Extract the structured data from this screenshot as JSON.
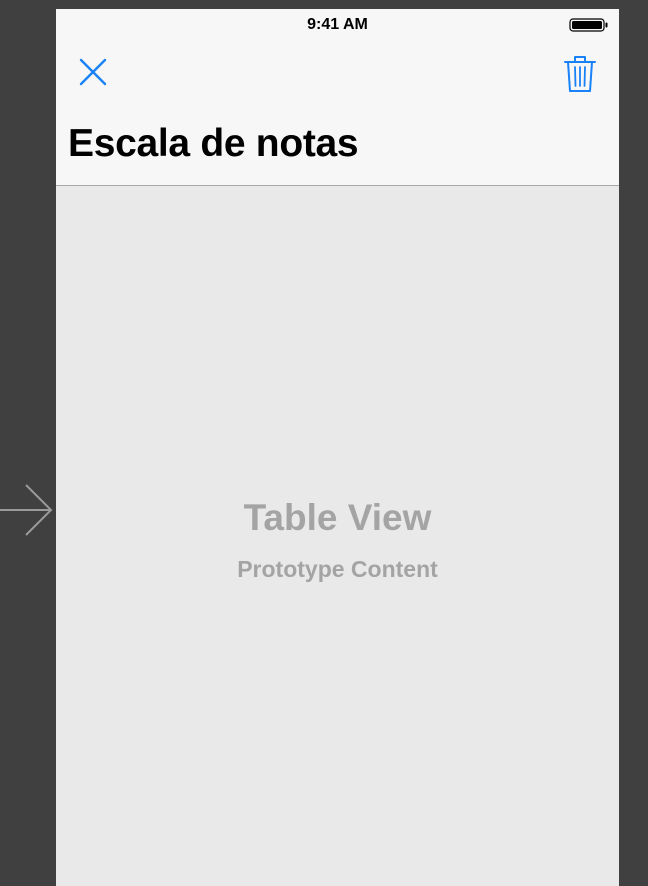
{
  "colors": {
    "canvas": "#404040",
    "navbar_background": "#f7f7f7",
    "content_background": "#e9e9e9",
    "tint": "#1a82f7",
    "placeholder_text": "#a4a4a4"
  },
  "storyboard": {
    "entry_point_icon": "arrow-right-icon"
  },
  "status_bar": {
    "time": "9:41 AM",
    "battery_icon": "battery-icon"
  },
  "navigation_bar": {
    "left_button_icon": "close-icon",
    "right_button_icon": "trash-icon",
    "title": "Escala de notas"
  },
  "table_view": {
    "title": "Table View",
    "subtitle": "Prototype Content"
  }
}
